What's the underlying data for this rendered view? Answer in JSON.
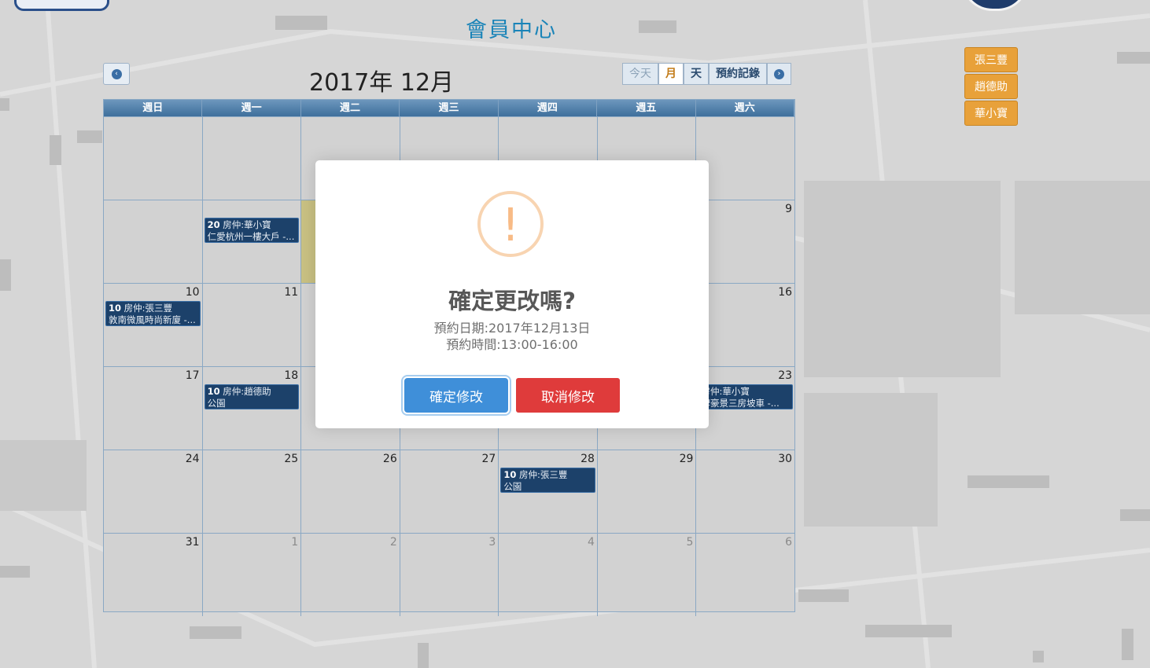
{
  "header": {
    "page_title": "會員中心"
  },
  "agents": [
    "張三豐",
    "趙德助",
    "華小寶"
  ],
  "calendar": {
    "title": "2017年 12月",
    "views": {
      "today": "今天",
      "month": "月",
      "day": "天",
      "records": "預約記錄"
    },
    "weekdays": [
      "週日",
      "週一",
      "週二",
      "週三",
      "週四",
      "週五",
      "週六"
    ],
    "weeks": [
      [
        {
          "n": ""
        },
        {
          "n": ""
        },
        {
          "n": ""
        },
        {
          "n": ""
        },
        {
          "n": ""
        },
        {
          "n": ""
        },
        {
          "n": ""
        }
      ],
      [
        {
          "n": ""
        },
        {
          "n": "",
          "event": {
            "time": "20",
            "line1": "房仲:華小寶",
            "line2": "仁愛杭州一樓大戶 -..."
          }
        },
        {
          "n": "",
          "today": true
        },
        {
          "n": ""
        },
        {
          "n": ""
        },
        {
          "n": ""
        },
        {
          "n": "9"
        }
      ],
      [
        {
          "n": "10",
          "event": {
            "time": "10",
            "line1": "房仲:張三豐",
            "line2": "敦南微風時尚新廈 -..."
          }
        },
        {
          "n": "11"
        },
        {
          "n": ""
        },
        {
          "n": ""
        },
        {
          "n": ""
        },
        {
          "n": ""
        },
        {
          "n": "16"
        }
      ],
      [
        {
          "n": "17"
        },
        {
          "n": "18",
          "event": {
            "time": "10",
            "line1": "房仲:趙德助",
            "line2": "公園"
          }
        },
        {
          "n": ""
        },
        {
          "n": ""
        },
        {
          "n": ""
        },
        {
          "n": ""
        },
        {
          "n": "23",
          "event": {
            "time": "",
            "line1": "房仲:華小寶",
            "line2": "牌豪景三房坡車 -..."
          }
        }
      ],
      [
        {
          "n": "24"
        },
        {
          "n": "25"
        },
        {
          "n": "26"
        },
        {
          "n": "27"
        },
        {
          "n": "28",
          "event": {
            "time": "10",
            "line1": "房仲:張三豐",
            "line2": "公園"
          }
        },
        {
          "n": "29"
        },
        {
          "n": "30"
        }
      ],
      [
        {
          "n": "31"
        },
        {
          "n": "1",
          "other": true
        },
        {
          "n": "2",
          "other": true
        },
        {
          "n": "3",
          "other": true
        },
        {
          "n": "4",
          "other": true
        },
        {
          "n": "5",
          "other": true
        },
        {
          "n": "6",
          "other": true
        }
      ]
    ]
  },
  "dialog": {
    "icon": "!",
    "title": "確定更改嗎?",
    "date_line": "預約日期:2017年12月13日",
    "time_line": "預約時間:13:00-16:00",
    "confirm_label": "確定修改",
    "cancel_label": "取消修改"
  }
}
